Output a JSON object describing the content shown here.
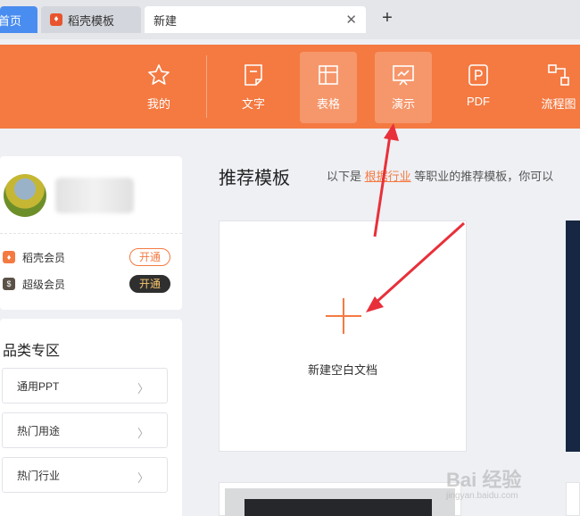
{
  "tabs": {
    "home": "首页",
    "docer": "稻壳模板",
    "new": "新建"
  },
  "toolbar": {
    "items": [
      {
        "label": "我的",
        "icon": "star-icon"
      },
      {
        "label": "文字",
        "icon": "document-icon"
      },
      {
        "label": "表格",
        "icon": "table-icon"
      },
      {
        "label": "演示",
        "icon": "presentation-icon"
      },
      {
        "label": "PDF",
        "icon": "pdf-icon"
      },
      {
        "label": "流程图",
        "icon": "flowchart-icon"
      }
    ]
  },
  "user_card": {
    "members": [
      {
        "label": "稻壳会员",
        "button": "开通"
      },
      {
        "label": "超级会员",
        "button": "开通"
      }
    ]
  },
  "category": {
    "title": "品类专区",
    "items": [
      "通用PPT",
      "热门用途",
      "热门行业"
    ]
  },
  "main": {
    "title": "推荐模板",
    "desc_prefix": "以下是",
    "desc_link": "根据行业",
    "desc_suffix": "等职业的推荐模板，你可以",
    "new_blank_label": "新建空白文档"
  },
  "watermark": {
    "text": "Bai 经验",
    "sub": "jingyan.baidu.com"
  },
  "colors": {
    "accent": "#f47a42",
    "tab_home": "#4a8df0",
    "arrow": "#e8303a"
  }
}
